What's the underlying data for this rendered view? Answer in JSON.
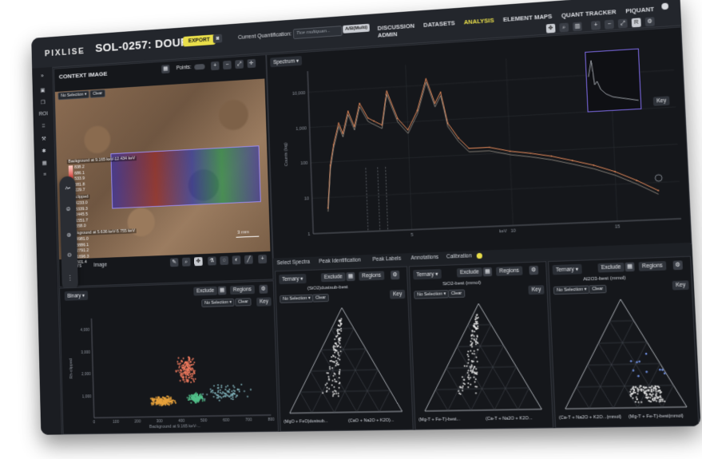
{
  "app": {
    "logo": "PIXLISE",
    "title": "SOL-0257: DOURBES",
    "export_label": "EXPORT"
  },
  "quant": {
    "label": "Current Quantification:",
    "placeholder": "Tice multiquan...",
    "badge": "A/B(Multi)"
  },
  "nav": {
    "items": [
      "DISCUSSION",
      "DATASETS",
      "ANALYSIS",
      "ELEMENT MAPS",
      "QUANT TRACKER",
      "PIQUANT",
      "ADMIN"
    ],
    "active": "ANALYSIS"
  },
  "sidebar": {
    "roi_label": "ROI"
  },
  "context": {
    "title": "CONTEXT IMAGE",
    "points_label": "Points:",
    "no_selection": "No Selection",
    "clear": "Clear",
    "tabs": [
      "Layers",
      "Image"
    ],
    "legend1": {
      "title": "Background at 9.165 keV-12.434 keV",
      "values": [
        "838.2",
        "686.1",
        "533.9",
        "381.8",
        "229.7"
      ],
      "color": "#d1312c"
    },
    "legend2": {
      "title": "Rh-clipped",
      "values": [
        "4233.0",
        "3339.3",
        "2445.5",
        "1551.7",
        "658.0"
      ],
      "color": "#3fbf4a"
    },
    "legend3": {
      "title": "Background at 5.636 keV-5.755 keV",
      "values": [
        "4981.0",
        "3886.1",
        "2791.2",
        "1696.3",
        "601.4"
      ],
      "color": "#3347e0"
    },
    "scale_label": "3 mm"
  },
  "spectrum": {
    "title": "Spectrum",
    "key": "Key",
    "tabs": [
      "Select Spectra",
      "Peak Identification",
      "Peak Labels",
      "Annotations",
      "Calibration"
    ],
    "ylabel": "Counts (log)",
    "xlabel": "keV",
    "y_ticks": [
      "10,000",
      "1,000",
      "100",
      "10",
      "1"
    ],
    "x_ticks": [
      "5",
      "10",
      "15"
    ]
  },
  "binary": {
    "mode": "Binary",
    "exclude": "Exclude",
    "regions": "Regions",
    "no_selection": "No Selection",
    "clear": "Clear",
    "key": "Key",
    "ylabel": "Rh-clipped",
    "xlabel": "Background at 9.165 keV-...",
    "y_ticks": [
      "4,000",
      "3,000",
      "2,000",
      "1,000"
    ],
    "x_ticks": [
      "0",
      "100",
      "200",
      "300",
      "400",
      "500",
      "600",
      "700",
      "800"
    ]
  },
  "ternaries": [
    {
      "mode": "Ternary",
      "exclude": "Exclude",
      "regions": "Regions",
      "no_selection": "No Selection",
      "clear": "Clear",
      "key": "Key",
      "top": "(SiO2)dustsub-best",
      "left": "(MgO + FeO)dustsub...",
      "right": "(CaO + Na2O + K2O)..."
    },
    {
      "mode": "Ternary",
      "exclude": "Exclude",
      "regions": "Regions",
      "no_selection": "No Selection",
      "clear": "Clear",
      "key": "Key",
      "top": "SiO2-best (mmol)",
      "left": "(Mg-T + Fe-T)-best...",
      "right": "(Ca-T + Na2O + K2O..."
    },
    {
      "mode": "Ternary",
      "exclude": "Exclude",
      "regions": "Regions",
      "no_selection": "No Selection",
      "clear": "Clear",
      "key": "Key",
      "top": "Al2O3-best (mmol)",
      "left": "(Ca-T + Na2O + K2O...(mmol)",
      "right": "(Mg-T + Fe-T)-best(mmol)"
    }
  ],
  "chart_data": [
    {
      "type": "line",
      "title": "Spectrum",
      "xlabel": "keV",
      "ylabel": "Counts (log)",
      "ylog": true,
      "xlim": [
        0,
        18
      ],
      "series": [
        {
          "name": "",
          "x": [
            0.8,
            1.0,
            1.2,
            1.5,
            1.7,
            2.0,
            2.3,
            2.6,
            3.0,
            3.3,
            3.7,
            4.0,
            4.5,
            5.0,
            5.5,
            6.0,
            6.4,
            6.7,
            7.0,
            7.5,
            8.0,
            9.0,
            10.0,
            11.0,
            12.0,
            13.0,
            14.0,
            15.0,
            16.0,
            17.0
          ],
          "y": [
            5,
            80,
            300,
            1200,
            600,
            2500,
            900,
            4000,
            1500,
            1200,
            900,
            8000,
            1300,
            600,
            2000,
            15000,
            3000,
            6000,
            800,
            300,
            150,
            150,
            110,
            90,
            70,
            50,
            35,
            22,
            12,
            6
          ]
        }
      ]
    },
    {
      "type": "scatter",
      "xlabel": "Background at 9.165 keV-...",
      "ylabel": "Rh-clipped",
      "xlim": [
        0,
        800
      ],
      "ylim": [
        0,
        4500
      ],
      "series": [
        {
          "name": "",
          "color": "#e8a23c",
          "center": [
            320,
            700
          ]
        },
        {
          "name": "",
          "color": "#f07a5e",
          "center": [
            430,
            2100
          ]
        },
        {
          "name": "",
          "color": "#52c08a",
          "center": [
            470,
            800
          ]
        },
        {
          "name": "",
          "color": "#7fb0b8",
          "center": [
            600,
            1000
          ]
        }
      ]
    }
  ]
}
